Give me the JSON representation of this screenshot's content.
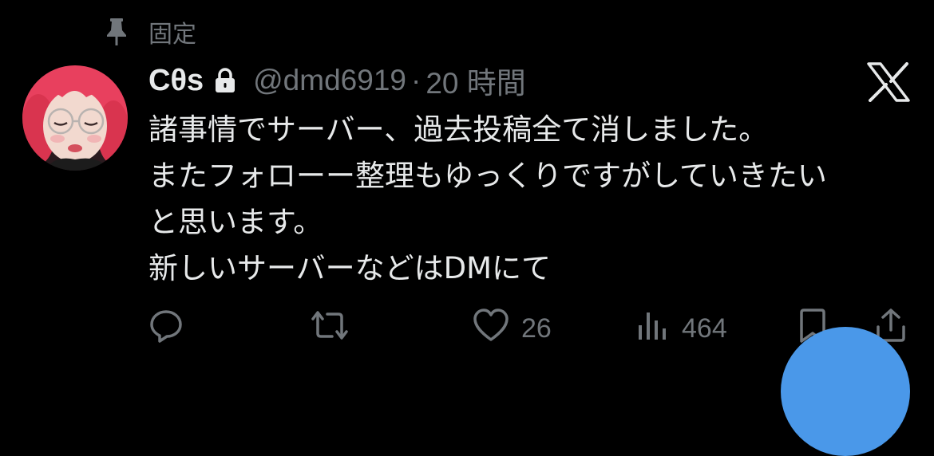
{
  "pinned": {
    "label": "固定",
    "icon": "pin-icon"
  },
  "tweet": {
    "display_name": "Cθs",
    "protected_icon": "lock-icon",
    "handle": "@dmd6919",
    "separator": "·",
    "timestamp": "20 時間",
    "body_lines": [
      "諸事情でサーバー、過去投稿全て消しました。",
      "またフォローー整理もゆっくりですがしていきたい",
      "と思います。",
      "新しいサーバーなどはDMにて"
    ],
    "source_logo": "x-logo"
  },
  "actions": {
    "reply": {
      "icon": "reply-icon"
    },
    "repost": {
      "icon": "repost-icon"
    },
    "like": {
      "icon": "heart-icon",
      "count": "26"
    },
    "views": {
      "icon": "views-icon",
      "count": "464"
    },
    "bookmark": {
      "icon": "bookmark-icon"
    },
    "share": {
      "icon": "share-icon"
    }
  },
  "colors": {
    "background": "#000000",
    "primary_text": "#e7e9ea",
    "secondary_text": "#71767b",
    "fab_blue": "#4a98e9",
    "avatar_hair": "#e8405e"
  }
}
